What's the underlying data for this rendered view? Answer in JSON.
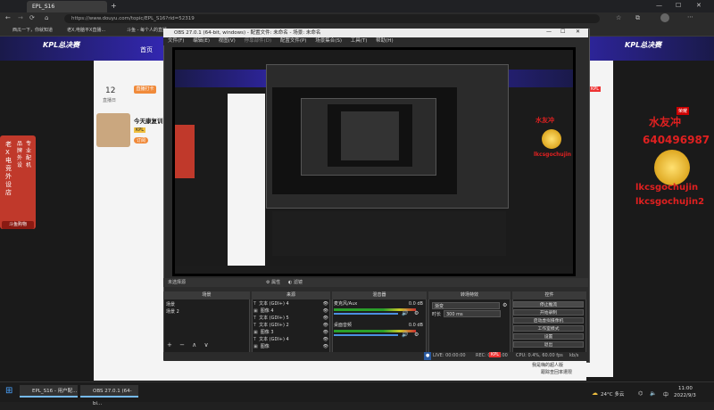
{
  "browser": {
    "tab_title": "EPL_S16",
    "new_tab": "+",
    "url": "https://www.douyu.com/topic/EPL_S16?rid=52319",
    "favorites": [
      "西瓜一下，你就知道",
      "老X,电脑平X直播...",
      "斗鱼 - 每个人的直播..."
    ],
    "window_controls": [
      "—",
      "☐",
      "✕"
    ]
  },
  "site": {
    "nav_home": "首页",
    "brand_left": "KPL总决赛",
    "brand_right": "KPL总决赛"
  },
  "left_panel": {
    "count": "12",
    "count_label": "直播日",
    "sub_label": "直播打卡",
    "streamer_title": "今天康复训",
    "tag": "KPL",
    "subscribe": "订阅"
  },
  "side_banner": {
    "lines": [
      "老X电竞外设店",
      "品牌外设",
      "专业配机"
    ],
    "cta": "斗鱼购物"
  },
  "right_overlay": {
    "name": "水友冲",
    "number": "640496987",
    "badge": "荣耀",
    "ids": [
      "lkcsgochujin",
      "lkcsgochujin2"
    ],
    "tag": "KPL"
  },
  "obs": {
    "title": "OBS 27.0.1 (64-bit, windows) - 配置文件: 未命名 - 场景: 未命名",
    "menu": [
      "文件(F)",
      "编辑(E)",
      "视图(V)",
      "停靠部件(D)",
      "配置文件(P)",
      "场景集合(S)",
      "工具(T)",
      "帮助(H)"
    ],
    "preview_bar": {
      "no_source": "未选择源",
      "props": "属性",
      "filters": "滤镜"
    },
    "docks": {
      "scenes": {
        "title": "场景",
        "items": [
          "场景",
          "场景 2"
        ]
      },
      "sources": {
        "title": "来源",
        "items": [
          "文本 (GDI+) 4",
          "图像 4",
          "文本 (GDI+) 5",
          "文本 (GDI+) 2",
          "图像 3",
          "文本 (GDI+) 4",
          "图像"
        ]
      },
      "mixer": {
        "title": "混音器",
        "tracks": [
          {
            "name": "麦克风/Aux",
            "db": "0.0 dB"
          },
          {
            "name": "桌面音频",
            "db": "0.0 dB"
          }
        ]
      },
      "transitions": {
        "title": "转场特效",
        "type": "渐变",
        "duration_label": "时长",
        "duration": "300 ms"
      },
      "controls": {
        "title": "控件",
        "buttons": [
          "停止推流",
          "开始录制",
          "启动虚拟摄像机",
          "工作室模式",
          "设置",
          "退出"
        ]
      }
    },
    "status": {
      "live": "LIVE: 00:00:00",
      "rec": "REC: 00:00:00",
      "cpu": "CPU: 0.4%, 60.00 fps",
      "kbps": "kb/s"
    }
  },
  "bottom_strip": {
    "tag": "KPL",
    "promo": "我是嗨的超人版",
    "link": "跟踪查回率遭限"
  },
  "taskbar": {
    "items": [
      {
        "label": "EPL_S16 - 用户配..."
      },
      {
        "label": "OBS 27.0.1 (64-bi..."
      }
    ],
    "weather": "24°C 多云",
    "time": "11:00",
    "date": "2022/9/3",
    "ime": "中"
  }
}
